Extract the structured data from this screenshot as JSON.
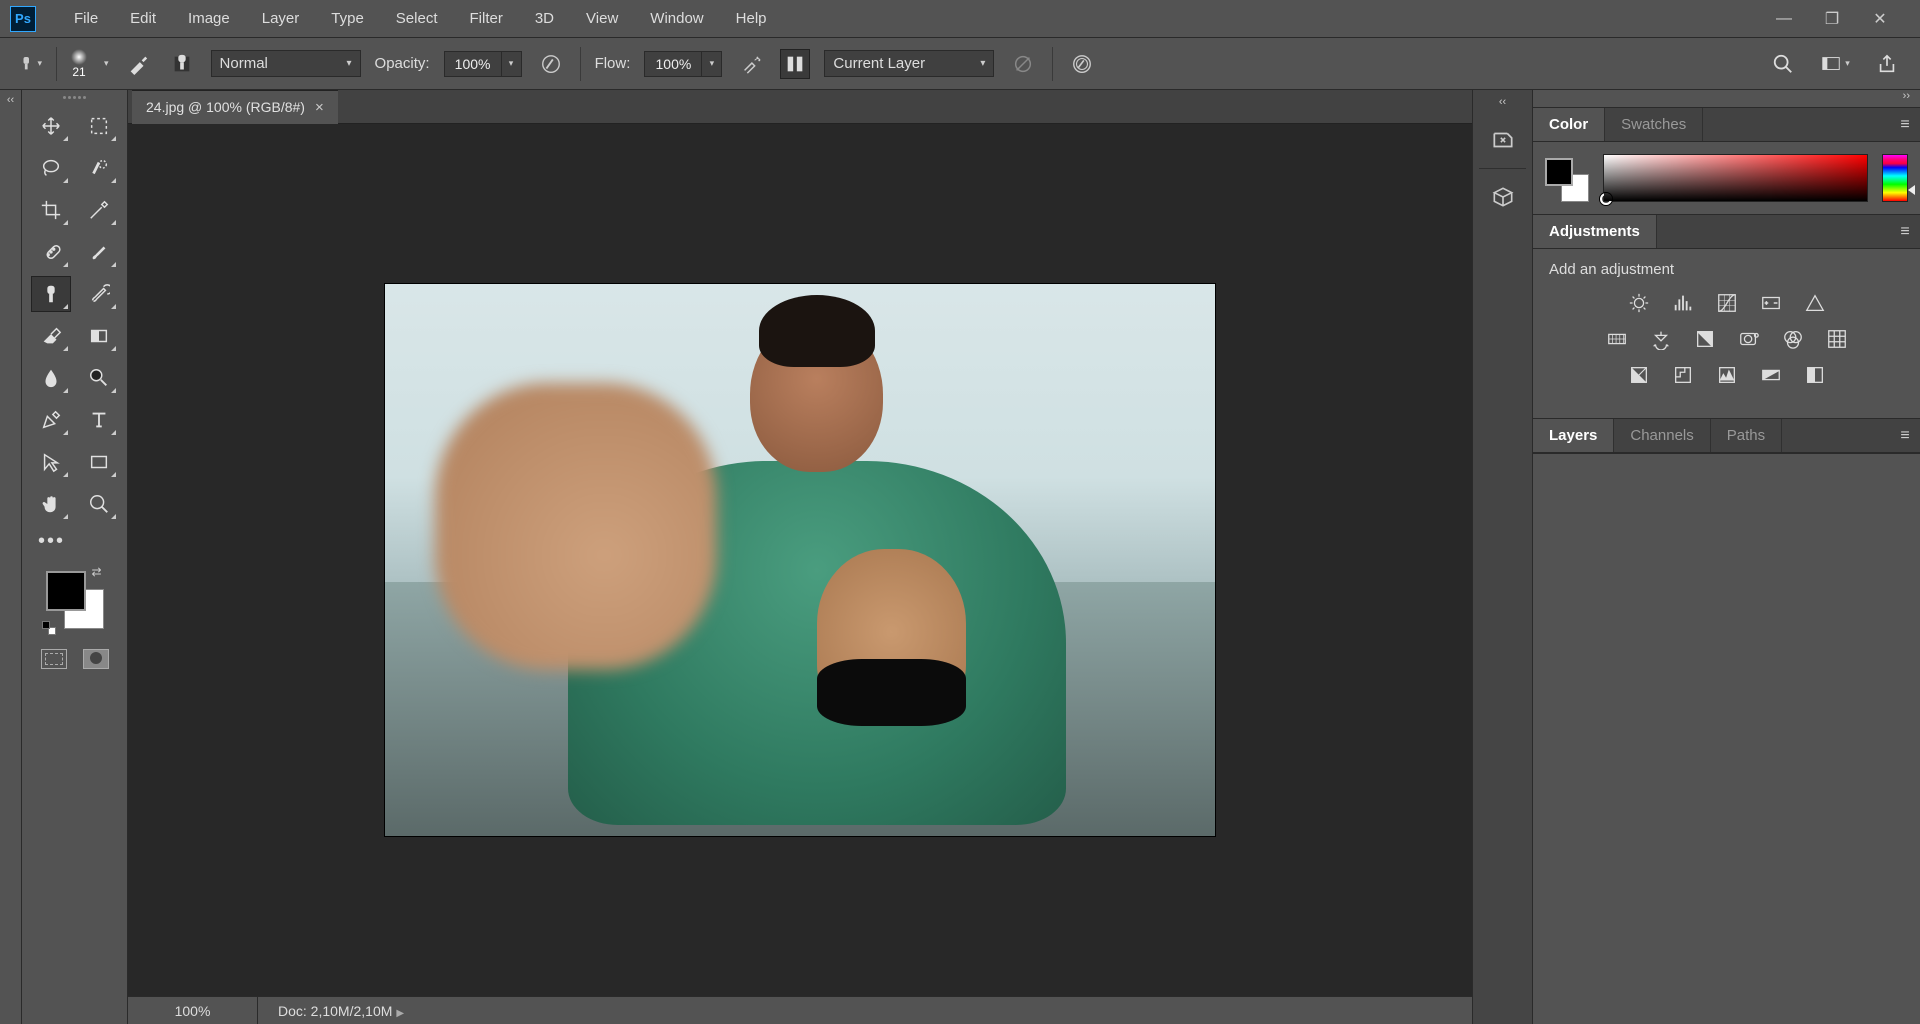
{
  "app": {
    "logo": "Ps"
  },
  "menu": [
    "File",
    "Edit",
    "Image",
    "Layer",
    "Type",
    "Select",
    "Filter",
    "3D",
    "View",
    "Window",
    "Help"
  ],
  "options": {
    "brush_size": "21",
    "mode_label": "Normal",
    "opacity_label": "Opacity:",
    "opacity_value": "100%",
    "flow_label": "Flow:",
    "flow_value": "100%",
    "sample_label": "Current Layer"
  },
  "document": {
    "tab_title": "24.jpg @ 100% (RGB/8#)",
    "status_zoom": "100%",
    "status_doc": "Doc: 2,10M/2,10M"
  },
  "tools": [
    "move",
    "marquee",
    "lasso",
    "magic-wand",
    "crop",
    "eyedropper",
    "healing",
    "brush",
    "stamp",
    "history-brush",
    "eraser",
    "gradient",
    "blur",
    "dodge",
    "pen",
    "type",
    "path-select",
    "rectangle",
    "hand",
    "zoom"
  ],
  "panels": {
    "color": {
      "tabs": [
        "Color",
        "Swatches"
      ],
      "active": 0
    },
    "adjustments": {
      "tabs": [
        "Adjustments"
      ],
      "active": 0,
      "heading": "Add an adjustment"
    },
    "layers": {
      "tabs": [
        "Layers",
        "Channels",
        "Paths"
      ],
      "active": 0
    }
  }
}
